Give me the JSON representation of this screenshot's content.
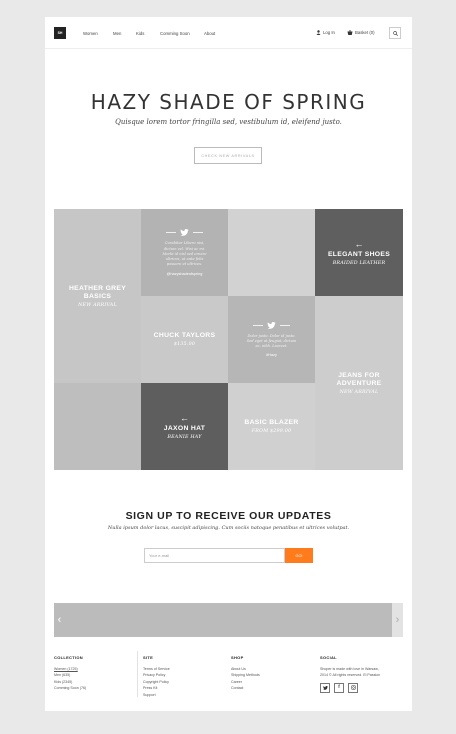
{
  "header": {
    "logo": "SH",
    "nav": [
      "Women",
      "Men",
      "Kids",
      "Comming Soon",
      "About"
    ],
    "login": "Log In",
    "basket": "Basket (0)"
  },
  "hero": {
    "title": "HAZY SHADE OF SPRING",
    "subtitle": "Quisque lorem tortor fringilla sed, vestibulum id, eleifend justo.",
    "button": "CHECK NEW ARRIVALS"
  },
  "grid": {
    "heather": {
      "title": "HEATHER GREY BASICS",
      "sub": "NEW ARRIVAL"
    },
    "tweet1": {
      "text": "Curabitur Libero nisi, dictum vel. Wisi ac mi. Morbi id nisl sed ornare ultrices, ut ante felis posuere et ultrices.",
      "handle": "@hazyshadeofspring"
    },
    "elegant": {
      "title": "ELEGANT SHOES",
      "sub": "BRAIDED LEATHER"
    },
    "chuck": {
      "title": "CHUCK TAYLORS",
      "sub": "$135.00"
    },
    "tweet2": {
      "text": "Dolor justo. Dolor id justo. Sed eget at feugiat, dictum ac, nibh. Laoreet.",
      "handle": "#Hazy"
    },
    "jeans": {
      "title": "JEANS FOR ADVENTURE",
      "sub": "NEW ARRIVAL"
    },
    "jaxon": {
      "title": "JAXON HAT",
      "sub": "BEANIE HAY"
    },
    "blazer": {
      "title": "BASIC BLAZER",
      "sub": "FROM $299.00"
    }
  },
  "signup": {
    "title": "SIGN UP TO RECEIVE OUR UPDATES",
    "subtitle": "Nulla ipsum dolor lacus, suscipit adipiscing. Cum sociis natoque penatibus et ultrices volutpat.",
    "placeholder": "Your e-mail",
    "button": "GO!"
  },
  "footer": {
    "collection": {
      "title": "COLLECTION",
      "items": [
        "Women (1725)",
        "Men (635)",
        "Kids (2345)",
        "Comming Soon (76)"
      ]
    },
    "site": {
      "title": "SITE",
      "items": [
        "Terms of Service",
        "Privacy Policy",
        "Copyright Policy",
        "Press Kit",
        "Support"
      ]
    },
    "shop": {
      "title": "SHOP",
      "items": [
        "About Us",
        "Shipping Methods",
        "Career",
        "Contact"
      ]
    },
    "social": {
      "title": "SOCIAL",
      "line1": "Shoper is made with love in Warsaw,",
      "line2": "2014 © All rights reserved. El Passion",
      "icons": [
        "twitter-icon",
        "facebook-icon",
        "instagram-icon"
      ]
    }
  }
}
